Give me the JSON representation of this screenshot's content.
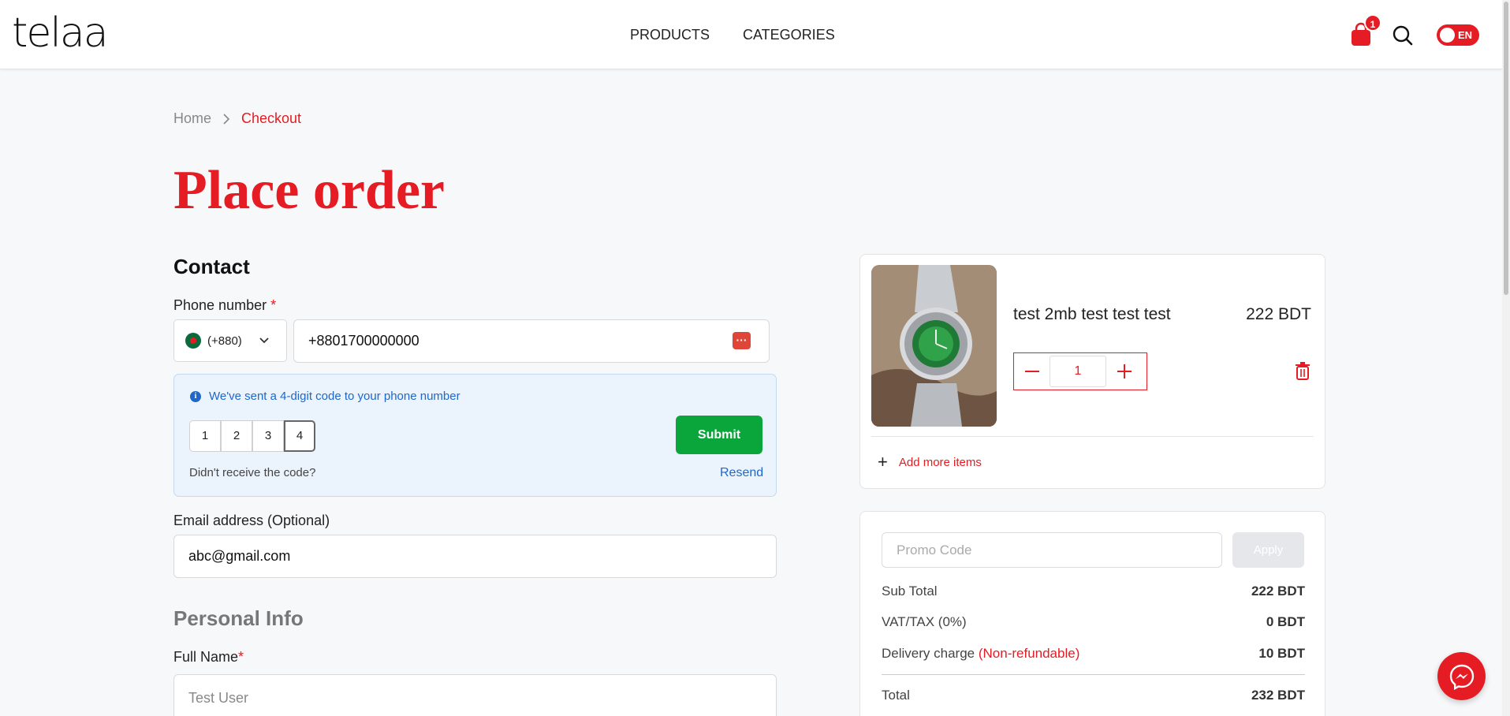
{
  "header": {
    "logo": "telaa",
    "nav": [
      "PRODUCTS",
      "CATEGORIES"
    ],
    "cart_count": "1",
    "language": "EN"
  },
  "breadcrumb": {
    "home": "Home",
    "current": "Checkout"
  },
  "page_title": "Place order",
  "contact": {
    "title": "Contact",
    "phone_label": "Phone number",
    "required_mark": "*",
    "country_code": "(+880)",
    "phone_value": "+8801700000000",
    "otp": {
      "message": "We've sent a 4-digit code to your phone number",
      "digits": [
        "1",
        "2",
        "3",
        "4"
      ],
      "submit_label": "Submit",
      "no_code_text": "Didn't receive the code?",
      "resend_label": "Resend"
    },
    "email_label": "Email address (Optional)",
    "email_value": "abc@gmail.com"
  },
  "personal_info": {
    "title": "Personal Info",
    "full_name_label": "Full Name",
    "required_mark": "*",
    "full_name_placeholder": "Test User"
  },
  "cart": {
    "item": {
      "name": "test 2mb test test test",
      "price": "222 BDT",
      "quantity": "1"
    },
    "add_more_label": "Add more items"
  },
  "summary": {
    "promo_placeholder": "Promo Code",
    "apply_label": "Apply",
    "sub_total_label": "Sub Total",
    "sub_total_value": "222 BDT",
    "vat_label": "VAT/TAX (0%)",
    "vat_value": "0 BDT",
    "delivery_label": "Delivery charge",
    "delivery_note": "(Non-refundable)",
    "delivery_value": "10 BDT",
    "total_label": "Total",
    "total_value": "232 BDT"
  },
  "colors": {
    "brand": "#e51c23",
    "success": "#0aa63c",
    "info": "#1f67c9"
  },
  "icons": [
    "shopping-bag-icon",
    "search-icon",
    "chevron-right-icon",
    "chevron-down-icon",
    "info-icon",
    "password-manager-icon",
    "minus-icon",
    "plus-icon",
    "trash-icon",
    "messenger-icon"
  ]
}
